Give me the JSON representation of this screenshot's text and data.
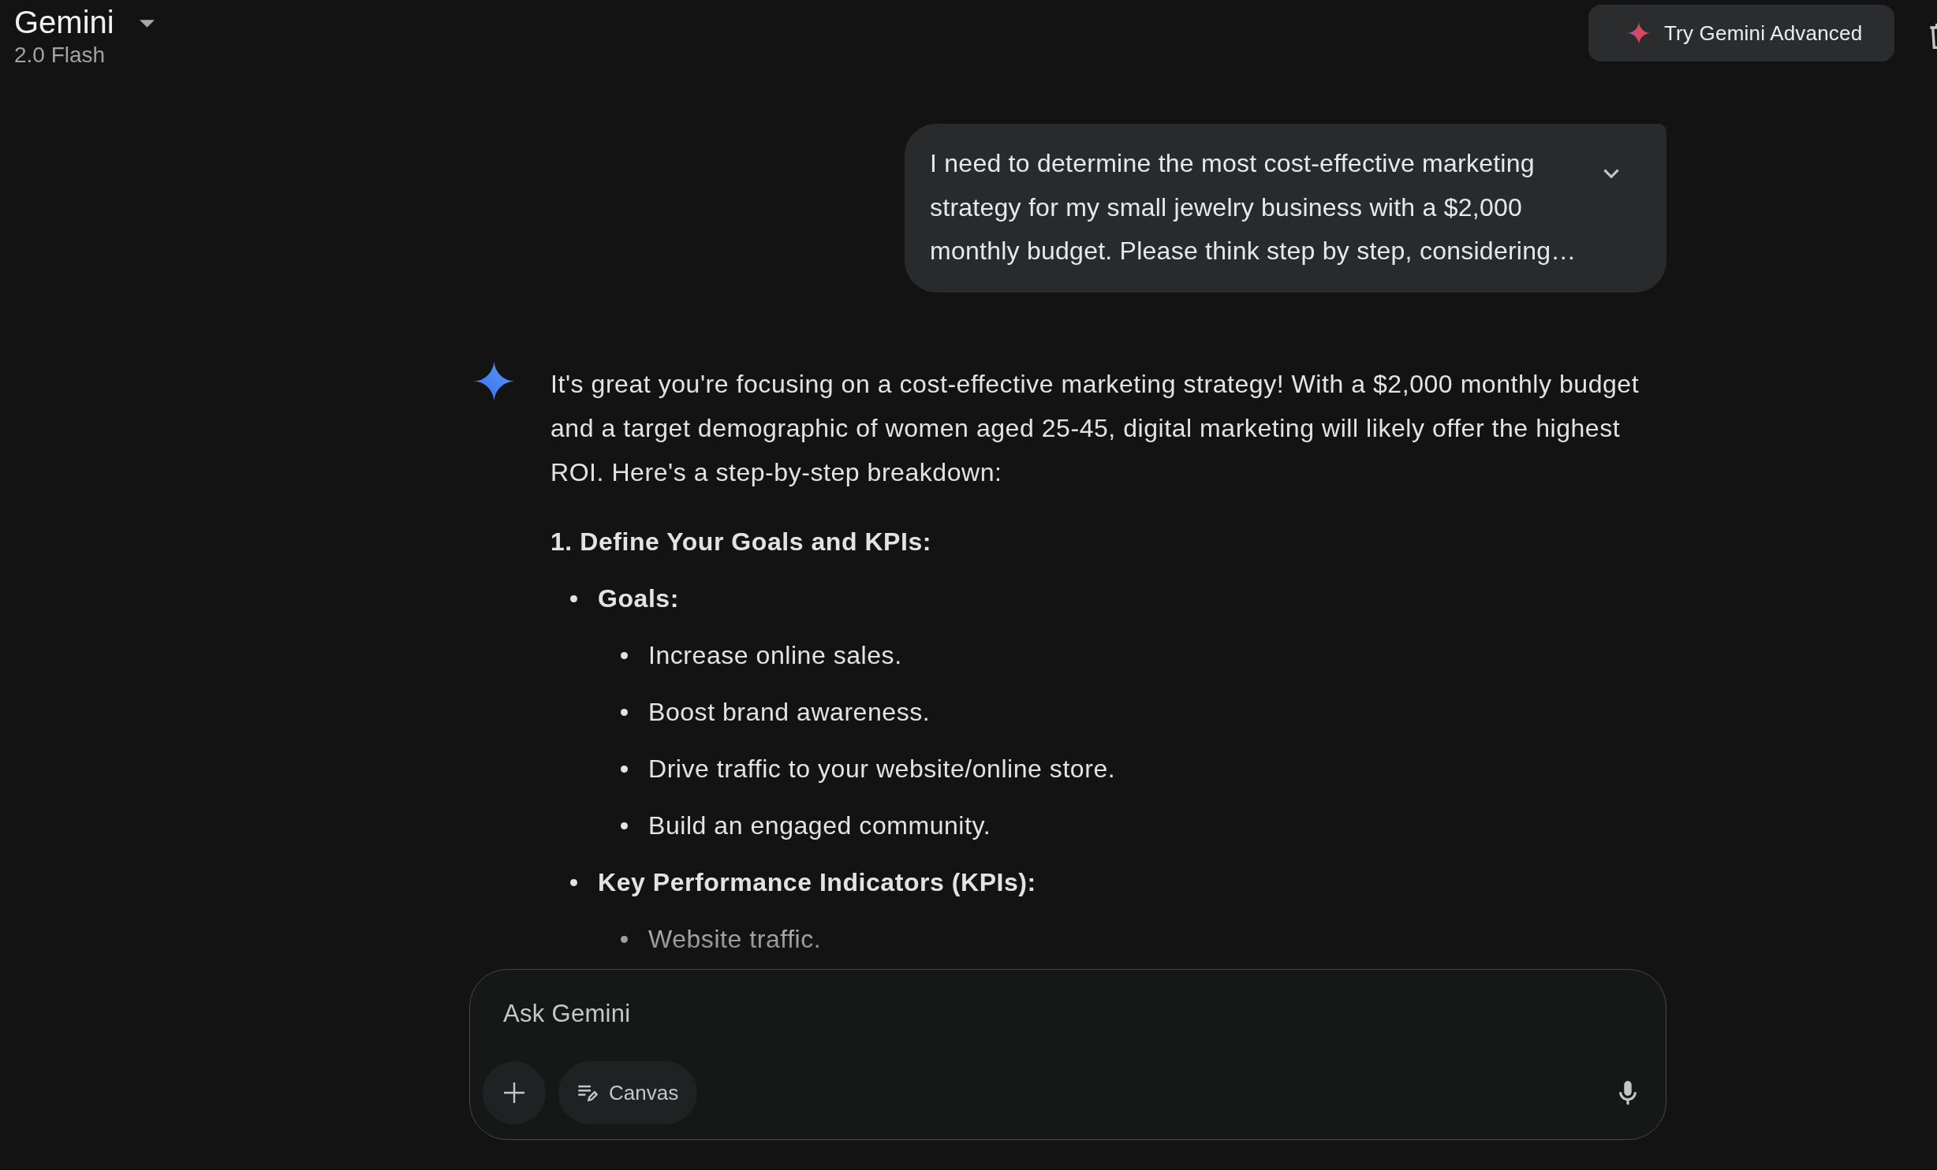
{
  "header": {
    "title": "Gemini",
    "model": "2.0 Flash",
    "upgrade_button": "Try Gemini Advanced"
  },
  "conversation": {
    "user_message": {
      "text": "I need to determine the most cost-effective marketing strategy for my small jewelry business with a $2,000 monthly budget. Please think step by step, considering…",
      "expanded": false
    },
    "response": {
      "intro": "It's great you're focusing on a cost-effective marketing strategy! With a $2,000 monthly budget and a target demographic of women aged 25-45, digital marketing will likely offer the highest ROI. Here's a step-by-step breakdown:",
      "sections": [
        {
          "heading": "1. Define Your Goals and KPIs:",
          "items": [
            {
              "text": "Goals:",
              "children": [
                {
                  "text": "Increase online sales."
                },
                {
                  "text": "Boost brand awareness."
                },
                {
                  "text": "Drive traffic to your website/online store."
                },
                {
                  "text": "Build an engaged community."
                }
              ]
            },
            {
              "text": "Key Performance Indicators (KPIs):",
              "children": [
                {
                  "text": "Website traffic."
                }
              ]
            }
          ]
        }
      ]
    }
  },
  "composer": {
    "placeholder": "Ask Gemini",
    "canvas_button": "Canvas"
  }
}
